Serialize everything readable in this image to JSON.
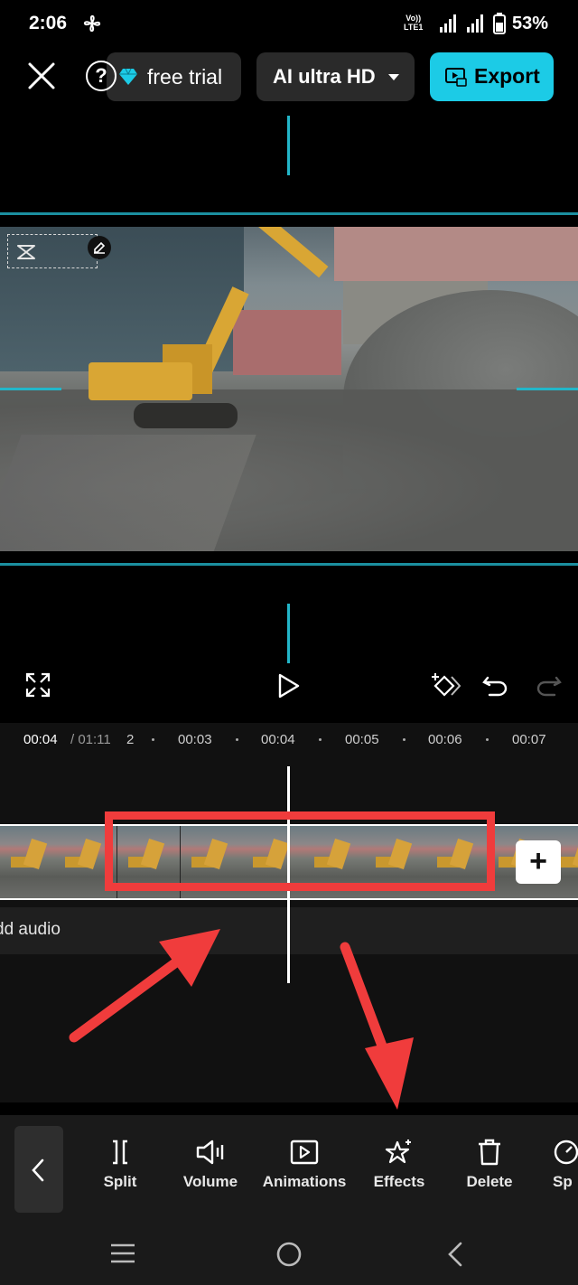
{
  "status_bar": {
    "time": "2:06",
    "volte": "Vo)) LTE1",
    "battery": "53%"
  },
  "top_bar": {
    "help": "?",
    "trial": "free trial",
    "hd_option": "AI ultra HD",
    "export": "Export"
  },
  "ruler": {
    "current": "00:04",
    "total": "/ 01:11",
    "marks": [
      "2",
      "00:03",
      "00:04",
      "00:05",
      "00:06",
      "00:07"
    ]
  },
  "timeline": {
    "add_audio": "dd audio",
    "add_clip": "+"
  },
  "toolbar": {
    "tools": [
      "Split",
      "Volume",
      "Animations",
      "Effects",
      "Delete",
      "Sp"
    ]
  },
  "colors": {
    "accent": "#1ccbe6",
    "guide": "#22b6c9",
    "highlight": "#f03c3c"
  }
}
